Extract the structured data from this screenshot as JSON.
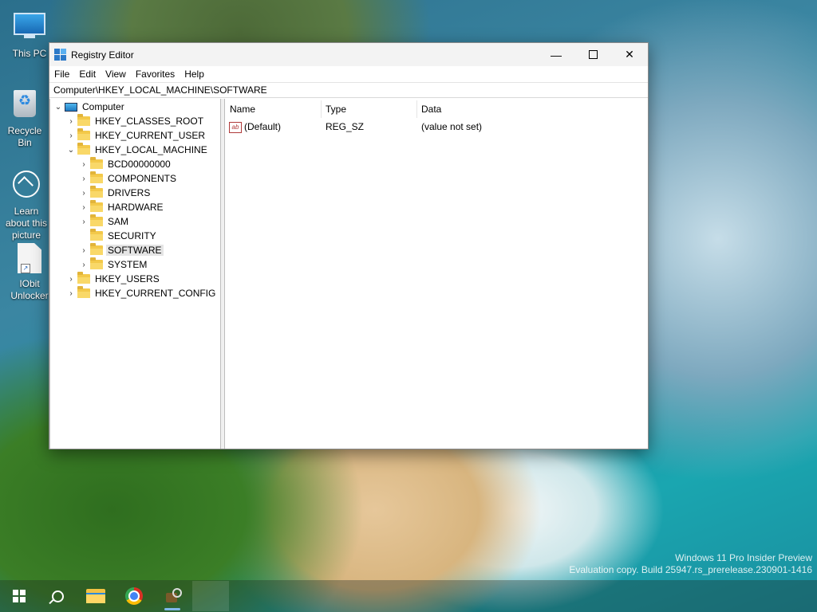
{
  "desktop": {
    "icons": [
      {
        "label": "This PC",
        "icon": "this-pc-icon"
      },
      {
        "label": "Recycle Bin",
        "icon": "recycle-bin-icon"
      },
      {
        "label": "Learn about this picture",
        "icon": "learn-about-picture-icon"
      },
      {
        "label": "IObit Unlocker",
        "icon": "shortcut-file-icon"
      }
    ],
    "watermark": {
      "line1": "Windows 11 Pro Insider Preview",
      "line2": "Evaluation copy. Build 25947.rs_prerelease.230901-1416"
    }
  },
  "window": {
    "title": "Registry Editor",
    "controls": {
      "minimize": "—",
      "close": "✕"
    },
    "menu": [
      "File",
      "Edit",
      "View",
      "Favorites",
      "Help"
    ],
    "address": "Computer\\HKEY_LOCAL_MACHINE\\SOFTWARE",
    "tree": {
      "root": "Computer",
      "hives": [
        {
          "label": "HKEY_CLASSES_ROOT"
        },
        {
          "label": "HKEY_CURRENT_USER"
        },
        {
          "label": "HKEY_LOCAL_MACHINE"
        },
        {
          "label": "HKEY_USERS"
        },
        {
          "label": "HKEY_CURRENT_CONFIG"
        }
      ],
      "hklm_children": [
        {
          "label": "BCD00000000"
        },
        {
          "label": "COMPONENTS"
        },
        {
          "label": "DRIVERS"
        },
        {
          "label": "HARDWARE"
        },
        {
          "label": "SAM"
        },
        {
          "label": "SECURITY"
        },
        {
          "label": "SOFTWARE",
          "selected": true
        },
        {
          "label": "SYSTEM"
        }
      ]
    },
    "list": {
      "columns": [
        "Name",
        "Type",
        "Data"
      ],
      "rows": [
        {
          "name": "(Default)",
          "type": "REG_SZ",
          "data": "(value not set)",
          "icon": "string-value-icon"
        }
      ]
    }
  },
  "taskbar": {
    "items": [
      "start-icon",
      "search-icon",
      "file-explorer-icon",
      "chrome-icon",
      "registry-editor-icon"
    ]
  }
}
